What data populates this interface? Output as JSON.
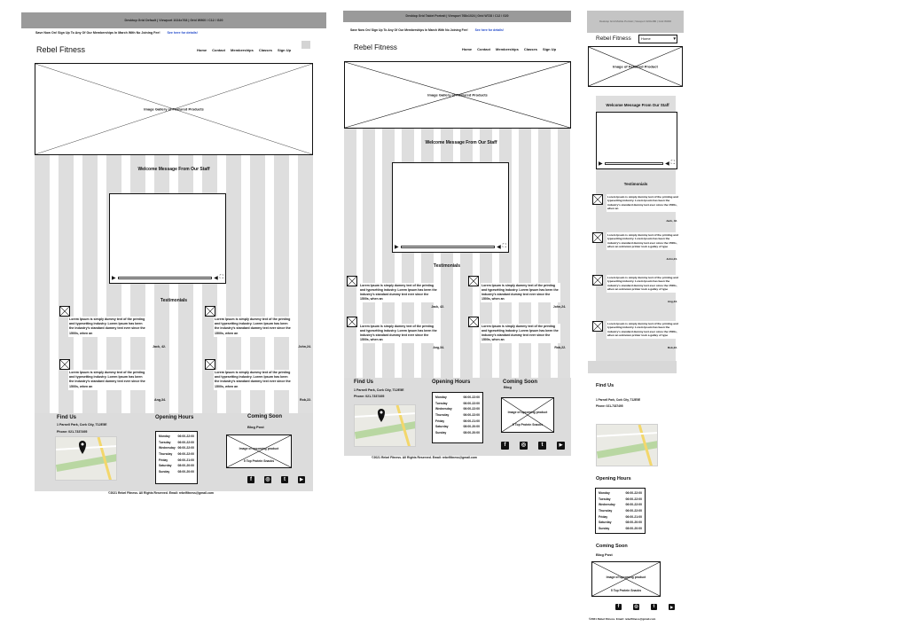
{
  "desktop": {
    "topbar": "Desktop Grid Default | Viewport 1024x768 | Grid W960 / C12 / G20",
    "promo": "Save Now On! Sign Up To Any Of Our Memberships In March With No Joining Fee!",
    "promo_link": "See here for details!",
    "brand": "Rebel Fitness",
    "nav": [
      "Home",
      "Contact",
      "Memberships",
      "Classes",
      "Sign Up"
    ],
    "hero_caption": "Image Gallery of Featured Products",
    "welcome": "Welcome Message From Our Staff",
    "testimonials_heading": "Testimonials",
    "testimonials": [
      {
        "text": "Lorem Ipsum is simply dummy text of the printing and typesetting industry. Lorem Ipsum has been the industry's standard dummy text ever since the 1500s, when an",
        "name": "Jack, 42."
      },
      {
        "text": "Lorem Ipsum is simply dummy text of the printing and typesetting industry. Lorem Ipsum has been the industry's standard dummy text ever since the 1500s, when an",
        "name": "John,24."
      },
      {
        "text": "Lorem Ipsum is simply dummy text of the printing and typesetting industry. Lorem Ipsum has been the industry's standard dummy text ever since the 1500s, when an",
        "name": "Ang,34."
      },
      {
        "text": "Lorem Ipsum is simply dummy text of the printing and typesetting industry. Lorem Ipsum has been the industry's standard dummy text ever since the 1500s, when an",
        "name": "Rob,22."
      }
    ],
    "find_us": "Find Us",
    "address": "1 Parnell Park, Cork City, T12E5E",
    "phone": "Phone: 021-7337495",
    "opening_hours": "Opening Hours",
    "coming_soon": "Coming Soon",
    "blog_post": "Blog Post",
    "blog_image": "Image of upcoming product",
    "blog_title": "5 Top Protein Snacks",
    "copyright": "©2021 Rebel Fitness. All Rights Reserved. Email: rebelfitness@gmail.com"
  },
  "tablet": {
    "topbar": "Desktop Grid Tablet Portrait | Viewport 768x1024 | Grid W728 / C12 / G20",
    "promo": "Save Now On! Sign Up To Any Of Our Memberships In March With No Joining Fee!",
    "promo_link": "See here for details!",
    "brand": "Rebel Fitness",
    "nav": [
      "Home",
      "Contact",
      "Memberships",
      "Classes",
      "Sign Up"
    ],
    "hero_caption": "Image Gallery of Featured Products",
    "welcome": "Welcome Message From Our Staff",
    "testimonials_heading": "Testimonials",
    "testimonials": [
      {
        "text": "Lorem Ipsum is simply dummy text of the printing and typesetting industry. Lorem Ipsum has been the industry's standard dummy text ever since the 1500s, when an",
        "name": "Jack, 42."
      },
      {
        "text": "Lorem Ipsum is simply dummy text of the printing and typesetting industry. Lorem Ipsum has been the industry's standard dummy text ever since the 1500s, when an",
        "name": "John,24."
      },
      {
        "text": "Lorem Ipsum is simply dummy text of the printing and typesetting industry. Lorem Ipsum has been the industry's standard dummy text ever since the 1500s, when an",
        "name": "Ang,34."
      },
      {
        "text": "Lorem Ipsum is simply dummy text of the printing and typesetting industry. Lorem Ipsum has been the industry's standard dummy text ever since the 1500s, when an",
        "name": "Rob,22."
      }
    ],
    "find_us": "Find Us",
    "address": "1 Parnell Park, Cork City, T12E5E",
    "phone": "Phone: 021-7337495",
    "opening_hours": "Opening Hours",
    "coming_soon": "Coming Soon",
    "blog_post": "Blog",
    "blog_image": "Image of upcoming product",
    "blog_title": "5 Top Protein Snacks",
    "copyright": "©2021 Rebel Fitness. All Rights Reserved. Email: rebelfitness@gmail.com"
  },
  "mobile": {
    "topbar": "Desktop Grid Mobile Portrait | Viewport 320x480 | Grid W300",
    "brand": "Rebel Fitness",
    "menu_select": "Home",
    "hero_caption": "Image of Featured Product",
    "welcome": "Welcome Message From Our Staff",
    "testimonials_heading": "Testimonials",
    "testimonials": [
      {
        "text": "Lorem Ipsum is simply dummy text of the printing and typesetting industry. Lorem Ipsum has been the industry's standard dummy text ever since the 1500s, when an",
        "name": "Jack, 42."
      },
      {
        "text": "Lorem Ipsum is simply dummy text of the printing and typesetting industry. Lorem Ipsum has been the industry's standard dummy text ever since the 1500s, when an unknown printer took a galley of type",
        "name": "John,24."
      },
      {
        "text": "Lorem Ipsum is simply dummy text of the printing and typesetting industry. Lorem Ipsum has been the industry's standard dummy text ever since the 1500s, when an unknown printer took a galley of type",
        "name": "Ang,34."
      },
      {
        "text": "Lorem Ipsum is simply dummy text of the printing and typesetting industry. Lorem Ipsum has been the industry's standard dummy text ever since the 1500s, when an unknown printer took a galley of type",
        "name": "Rob,22."
      }
    ],
    "find_us": "Find Us",
    "address": "1 Parnell Park, Cork City, T12E5E",
    "phone": "Phone: 021-7337495",
    "opening_hours": "Opening Hours",
    "coming_soon": "Coming Soon",
    "blog_post": "Blog Post",
    "blog_image": "Image of upcoming product",
    "blog_title": "5 Top Protein Snacks",
    "copyright": "©2021 Rebel Fitness. Email: rebelfitness@gmail.com"
  },
  "hours": [
    {
      "day": "Monday",
      "time": "06:00-22:00"
    },
    {
      "day": "Tuesday",
      "time": "06:00-22:00"
    },
    {
      "day": "Wednesday",
      "time": "06:00-22:00"
    },
    {
      "day": "Thursday",
      "time": "06:00-22:00"
    },
    {
      "day": "Friday",
      "time": "06:00-21:00"
    },
    {
      "day": "Saturday",
      "time": "08:00-20:00"
    },
    {
      "day": "Sunday",
      "time": "08:00-20:00"
    }
  ],
  "icons": [
    "facebook-icon",
    "instagram-icon",
    "twitter-icon",
    "youtube-icon"
  ]
}
